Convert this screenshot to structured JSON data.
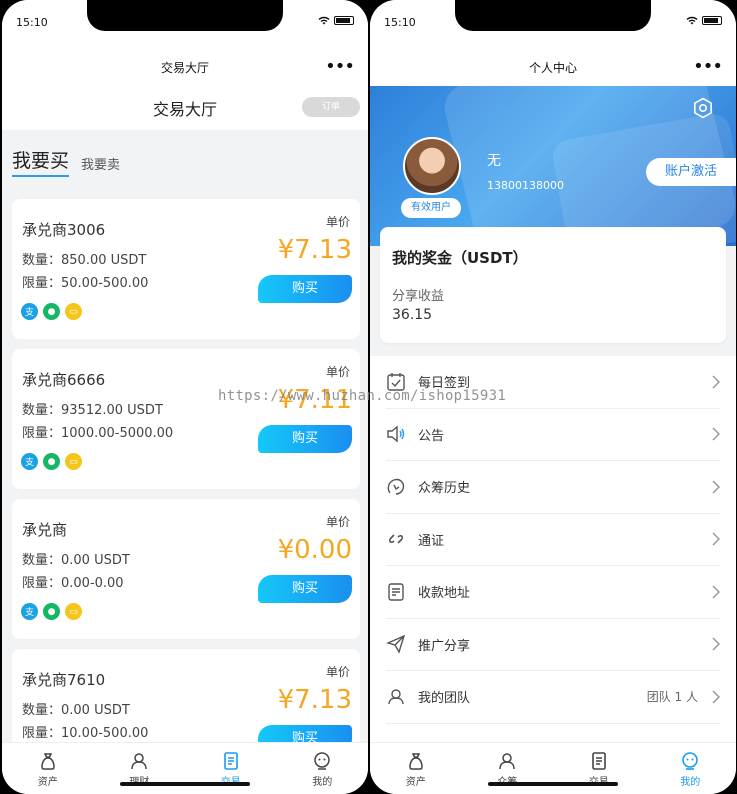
{
  "status_bar": {
    "time": "15:10"
  },
  "left": {
    "nav_title": "交易大厅",
    "more": "•••",
    "page_title": "交易大厅",
    "order_button": "订单",
    "tabs": {
      "buy": "我要买",
      "sell": "我要卖"
    },
    "unit_price_label": "单价",
    "buy_label": "购买",
    "cards": [
      {
        "merchant": "承兑商3006",
        "qty": "数量：850.00 USDT",
        "limit": "限量：50.00-500.00",
        "price": "¥7.13"
      },
      {
        "merchant": "承兑商6666",
        "qty": "数量：93512.00 USDT",
        "limit": "限量：1000.00-5000.00",
        "price": "¥7.11"
      },
      {
        "merchant": "承兑商",
        "qty": "数量：0.00 USDT",
        "limit": "限量：0.00-0.00",
        "price": "¥0.00"
      },
      {
        "merchant": "承兑商7610",
        "qty": "数量：0.00 USDT",
        "limit": "限量：10.00-500.00",
        "price": "¥7.13"
      }
    ],
    "pay_icons": [
      "alipay-icon",
      "wechat-icon",
      "bankcard-icon"
    ],
    "pay_glyphs": {
      "ali": "支",
      "wx": "●",
      "bank": "▭"
    },
    "tabbar": [
      "资产",
      "理财",
      "交易",
      "我的"
    ]
  },
  "right": {
    "nav_title": "个人中心",
    "more": "•••",
    "username": "无",
    "phone": "13800138000",
    "status_tag": "有效用户",
    "activate": "账户激活",
    "bonus_title": "我的奖金（USDT）",
    "share_label": "分享收益",
    "share_value": "36.15",
    "menu": [
      {
        "label": "每日签到",
        "icon": "calendar-check-icon"
      },
      {
        "label": "公告",
        "icon": "speaker-icon"
      },
      {
        "label": "众筹历史",
        "icon": "history-icon"
      },
      {
        "label": "通证",
        "icon": "link-icon"
      },
      {
        "label": "收款地址",
        "icon": "document-icon"
      },
      {
        "label": "推广分享",
        "icon": "paper-plane-icon"
      },
      {
        "label": "我的团队",
        "icon": "team-icon",
        "extra": "团队 1 人"
      }
    ],
    "tabbar": [
      "资产",
      "众筹",
      "交易",
      "我的"
    ]
  },
  "watermark": "https://www.huzhan.com/ishop15931",
  "colors": {
    "accent": "#1a9af0",
    "price": "#f5a623",
    "wechat": "#15b765",
    "alipay": "#1aa1e6",
    "bank": "#f5c51b"
  }
}
